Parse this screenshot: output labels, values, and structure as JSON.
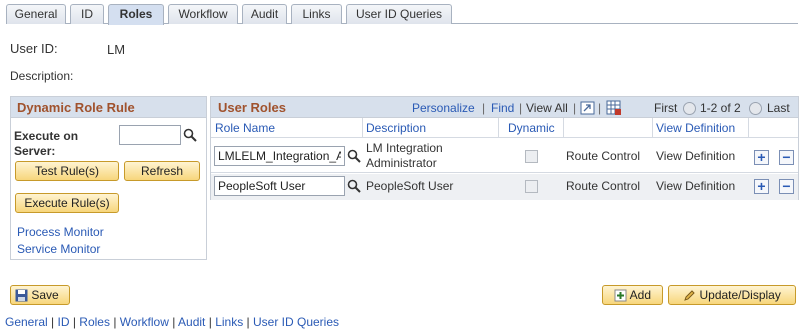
{
  "tabs": [
    "General",
    "ID",
    "Roles",
    "Workflow",
    "Audit",
    "Links",
    "User ID Queries"
  ],
  "active_tab": "Roles",
  "user_id": {
    "label": "User ID:",
    "value": "LM"
  },
  "description": {
    "label": "Description:"
  },
  "dynamic_role_rule": {
    "title": "Dynamic Role Rule",
    "execute_on_server_label": "Execute on Server:",
    "execute_on_server_value": "",
    "test_rules_label": "Test Rule(s)",
    "refresh_label": "Refresh",
    "execute_rules_label": "Execute Rule(s)",
    "process_monitor_label": "Process Monitor",
    "service_monitor_label": "Service Monitor"
  },
  "user_roles": {
    "title": "User Roles",
    "personalize": "Personalize",
    "find": "Find",
    "view_all": "View All",
    "first": "First",
    "range": "1-2 of 2",
    "last": "Last",
    "columns": [
      "Role Name",
      "Description",
      "Dynamic",
      "View Definition"
    ],
    "rows": [
      {
        "role_name": "LMLELM_Integration_Ac",
        "description": "LM Integration Administrator",
        "dynamic": false,
        "route_control": "Route Control",
        "view_definition": "View Definition"
      },
      {
        "role_name": "PeopleSoft User",
        "description": "PeopleSoft User",
        "dynamic": false,
        "route_control": "Route Control",
        "view_definition": "View Definition"
      }
    ]
  },
  "buttons": {
    "save": "Save",
    "add": "Add",
    "update_display": "Update/Display"
  },
  "footer_links": [
    "General",
    "ID",
    "Roles",
    "Workflow",
    "Audit",
    "Links",
    "User ID Queries"
  ],
  "colors": {
    "header_bg": "#d7e0ec",
    "title": "#a0522d",
    "link": "#2a5ab5",
    "button": "#f7d67c"
  }
}
